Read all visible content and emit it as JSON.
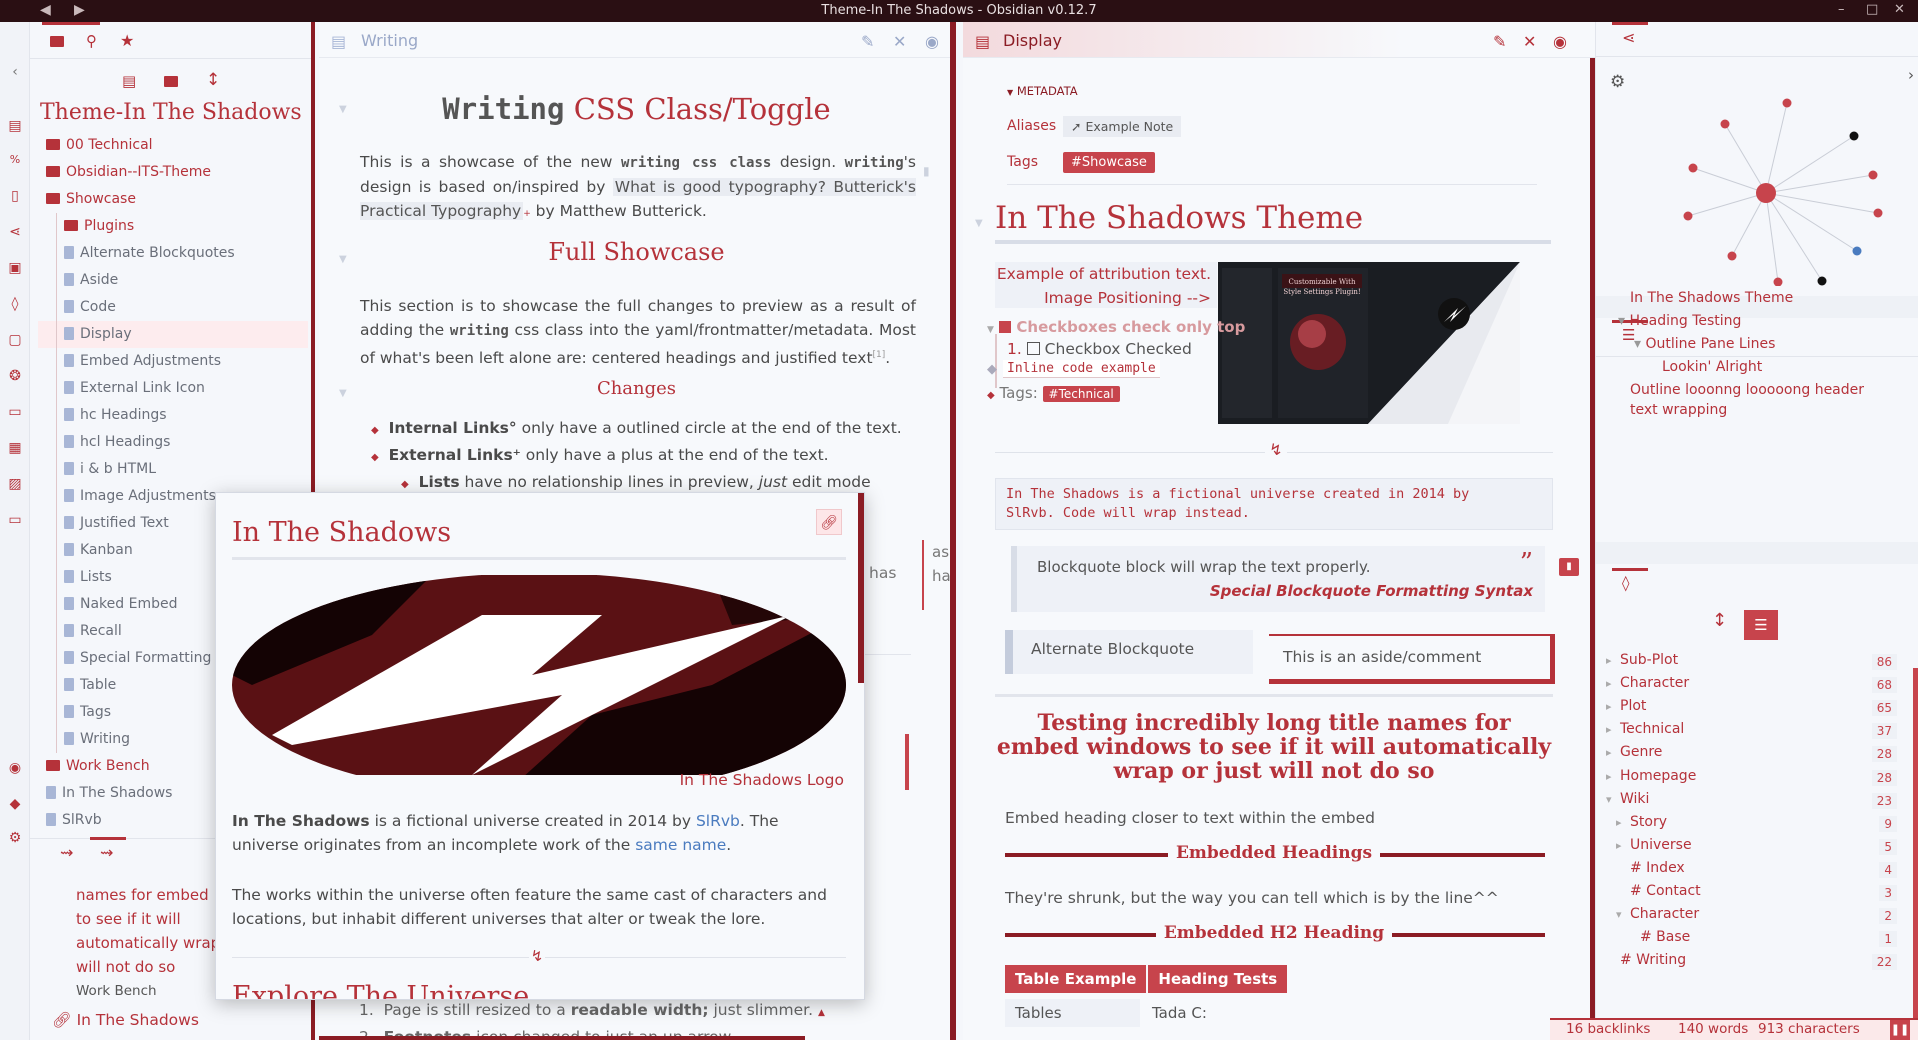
{
  "window": {
    "title": "Theme-In The Shadows - Obsidian v0.12.7"
  },
  "left_sidebar": {
    "vault_name": "Theme-In The Shadows",
    "tree": [
      {
        "label": "00 Technical",
        "type": "folder",
        "depth": 0
      },
      {
        "label": "Obsidian--ITS-Theme",
        "type": "folder",
        "depth": 0
      },
      {
        "label": "Showcase",
        "type": "folder",
        "depth": 0
      },
      {
        "label": "Plugins",
        "type": "folder",
        "depth": 1
      },
      {
        "label": "Alternate Blockquotes",
        "type": "file",
        "depth": 1
      },
      {
        "label": "Aside",
        "type": "file",
        "depth": 1
      },
      {
        "label": "Code",
        "type": "file",
        "depth": 1
      },
      {
        "label": "Display",
        "type": "file",
        "depth": 1,
        "active": true
      },
      {
        "label": "Embed Adjustments",
        "type": "file",
        "depth": 1
      },
      {
        "label": "External Link Icon",
        "type": "file",
        "depth": 1
      },
      {
        "label": "hc Headings",
        "type": "file",
        "depth": 1
      },
      {
        "label": "hcl Headings",
        "type": "file",
        "depth": 1
      },
      {
        "label": "i & b HTML",
        "type": "file",
        "depth": 1
      },
      {
        "label": "Image Adjustments",
        "type": "file",
        "depth": 1
      },
      {
        "label": "Justified Text",
        "type": "file",
        "depth": 1
      },
      {
        "label": "Kanban",
        "type": "file",
        "depth": 1
      },
      {
        "label": "Lists",
        "type": "file",
        "depth": 1
      },
      {
        "label": "Naked Embed",
        "type": "file",
        "depth": 1
      },
      {
        "label": "Recall",
        "type": "file",
        "depth": 1
      },
      {
        "label": "Special Formatting",
        "type": "file",
        "depth": 1
      },
      {
        "label": "Table",
        "type": "file",
        "depth": 1
      },
      {
        "label": "Tags",
        "type": "file",
        "depth": 1
      },
      {
        "label": "Writing",
        "type": "file",
        "depth": 1
      },
      {
        "label": "Work Bench",
        "type": "folder",
        "depth": 0
      },
      {
        "label": "In The Shadows",
        "type": "file",
        "depth": 0
      },
      {
        "label": "SlRvb",
        "type": "file",
        "depth": 0
      }
    ],
    "bottom": {
      "lines": [
        "names for embed",
        "to see if it will",
        "automatically wrap",
        "will not do so"
      ],
      "file": "Work Bench",
      "link": "In The Shadows"
    }
  },
  "writing": {
    "tab_title": "Writing",
    "h1_plain": "Writing",
    "h1_red": "CSS Class/Toggle",
    "p1a": "This is a showcase of the new ",
    "p1code": "writing css class",
    "p1b": " design. ",
    "p1code2": "writing",
    "p1c": "'s design is based on/inspired by ",
    "p1hl": "What is good typography? Butterick's Practical Typography",
    "p1d": " by Matthew Butterick.",
    "h2": "Full Showcase",
    "p2a": "This section is to showcase the full changes to preview as a result of adding the ",
    "p2code": "writing",
    "p2b": " css class into the yaml/frontmatter/metadata. Most of what's been left alone are: centered headings and justified text",
    "p2fn": "[1]",
    "h3": "Changes",
    "list": [
      {
        "bold": "Internal Links°",
        "text": " only have a outlined circle at the end of the text."
      },
      {
        "bold": "External Links⁺",
        "text": " only have a plus at the end of the text."
      }
    ],
    "sublist": {
      "bold": "Lists",
      "text": " have no relationship lines in preview, ",
      "italic": "just",
      "text2": " edit mode"
    },
    "frag1": "has",
    "ol": [
      {
        "n": "1.",
        "text": "Page is still resized to a ",
        "bold": "readable width;",
        "text2": " just slimmer."
      },
      {
        "n": "2.",
        "bold": "Footnotes",
        "text": " icon changed to just an up arrow"
      }
    ]
  },
  "popover": {
    "title": "In The Shadows",
    "caption": "In The Shadows Logo",
    "p1bold": "In The Shadows",
    "p1a": " is a fictional universe created in 2014 by ",
    "p1link": "SlRvb",
    "p1b": ". The universe originates from an incomplete work of the ",
    "p1link2": "same name",
    "p1c": ".",
    "p2": "The works within the universe often feature the same cast of characters and locations, but inhabit different universes that alter or tweak the lore.",
    "h2partial": "Explore The Universe"
  },
  "display": {
    "tab_title": "Display",
    "metadata_label": "METADATA",
    "aliases_label": "Aliases",
    "alias_value": "Example Note",
    "tags_label": "Tags",
    "tag_value": "#Showcase",
    "h1": "In The Shadows Theme",
    "attribution1": "Example of attribution text.",
    "attribution2": "Image Positioning -->",
    "checkbox_head": "Checkboxes check only top",
    "checkbox_item": "Checkbox Checked",
    "checkbox_num": "1.",
    "inline_code": "Inline code example",
    "tags_inline_label": "Tags:",
    "tags_inline_value": "#Technical",
    "image_caption_a": "Customizable With",
    "image_caption_b": "Style Settings Plugin!",
    "code_block": "In The Shadows is a fictional universe created in 2014 by\nSlRvb. Code will wrap instead.",
    "blockquote": "Blockquote block will wrap the text properly.",
    "blockquote_attr": "Special Blockquote Formatting Syntax",
    "quote_glyph": "”",
    "alt_blockquote": "Alternate Blockquote",
    "aside": "This is an aside/comment",
    "embed_title": "Testing incredibly long title names for embed windows to see if it will automatically wrap or just will not do so",
    "embed_p1": "Embed heading closer to text within the embed",
    "embed_h1": "Embedded Headings",
    "embed_p2": "They're shrunk, but the way you can tell which is by the line^^",
    "embed_h2": "Embedded H2 Heading",
    "table_headers": [
      "Table Example",
      "Heading Tests"
    ],
    "table_row": [
      "Tables",
      "Tada C:"
    ]
  },
  "right_sidebar": {
    "outline": [
      {
        "label": "In The Shadows Theme",
        "indent": 0
      },
      {
        "label": "Heading Testing",
        "indent": 0,
        "caret": true
      },
      {
        "label": "Outline Pane Lines",
        "indent": 1,
        "caret": true
      },
      {
        "label": "Lookin' Alright",
        "indent": 2
      },
      {
        "label": "Outline looonng looooong header text wrapping",
        "indent": 0
      }
    ],
    "tags": [
      {
        "label": "Sub-Plot",
        "count": "86",
        "indent": 0,
        "caret": "▸"
      },
      {
        "label": "Character",
        "count": "68",
        "indent": 0,
        "caret": "▸"
      },
      {
        "label": "Plot",
        "count": "65",
        "indent": 0,
        "caret": "▸"
      },
      {
        "label": "Technical",
        "count": "37",
        "indent": 0,
        "caret": "▸"
      },
      {
        "label": "Genre",
        "count": "28",
        "indent": 0,
        "caret": "▸"
      },
      {
        "label": "Homepage",
        "count": "28",
        "indent": 0,
        "caret": "▸"
      },
      {
        "label": "Wiki",
        "count": "23",
        "indent": 0,
        "caret": "▾"
      },
      {
        "label": "Story",
        "count": "9",
        "indent": 1,
        "caret": "▸"
      },
      {
        "label": "Universe",
        "count": "5",
        "indent": 1,
        "caret": "▸"
      },
      {
        "label": "# Index",
        "count": "4",
        "indent": 1,
        "caret": ""
      },
      {
        "label": "# Contact",
        "count": "3",
        "indent": 1,
        "caret": ""
      },
      {
        "label": "Character",
        "count": "2",
        "indent": 1,
        "caret": "▾"
      },
      {
        "label": "# Base",
        "count": "1",
        "indent": 2,
        "caret": ""
      },
      {
        "label": "# Writing",
        "count": "22",
        "indent": 0,
        "caret": ""
      }
    ]
  },
  "status": {
    "backlinks": "16 backlinks",
    "words": "140 words",
    "chars": "913 characters"
  }
}
